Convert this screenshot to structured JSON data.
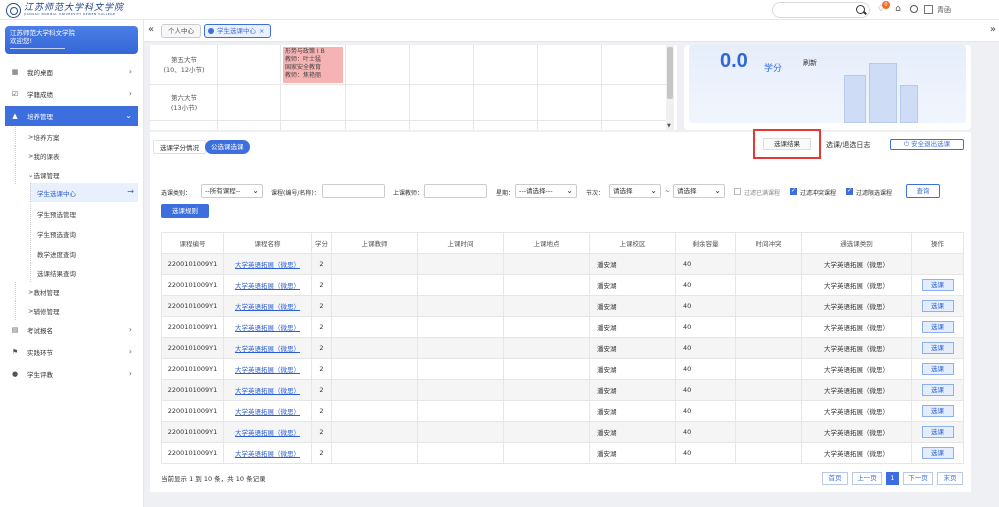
{
  "header": {
    "logo_cn": "江苏师范大学科文学院",
    "logo_en": "JIANGSU NORMAL UNIVERSITY KEWEN COLLEGE",
    "notification_count": "0",
    "user_name": "青函"
  },
  "sidebar": {
    "school_name": "江苏师范大学科文学院",
    "welcome": "欢迎您!",
    "items": [
      {
        "label": "我的桌面",
        "icon": "grid-icon"
      },
      {
        "label": "学籍成绩",
        "icon": "checkbox-icon"
      },
      {
        "label": "培养管理",
        "icon": "graduation-cap-icon"
      },
      {
        "label": "考试报名",
        "icon": "document-icon"
      },
      {
        "label": "实践环节",
        "icon": "flag-icon"
      },
      {
        "label": "学生评教",
        "icon": "person-icon"
      }
    ],
    "sub_items": [
      "培养方案",
      "我的课表",
      "选课管理",
      "教材管理",
      "辅修管理"
    ],
    "course_sub": [
      "学生选课中心",
      "学生预选管理",
      "学生预选查询",
      "教学进度查询",
      "选课结果查询"
    ]
  },
  "tabs": [
    {
      "label": "个人中心"
    },
    {
      "label": "学生选课中心"
    }
  ],
  "timetable": {
    "rows": [
      {
        "label_line1": "第五大节",
        "label_line2": "(10、12小节)"
      },
      {
        "label_line1": "第六大节",
        "label_line2": "(13小节)"
      }
    ],
    "course_block": [
      "形势与政策 I B",
      "教师：叶士猛",
      "国家安全教育",
      "教师：焦艳丽"
    ]
  },
  "credit": {
    "value": "0.0",
    "unit": "学分",
    "refresh_label": "刷新"
  },
  "actions": {
    "result_label": "选课结果",
    "log_label": "选课/退选日志",
    "exit_label": "安全退出选课"
  },
  "subtabs": {
    "credit_status": "选课学分情况",
    "public_elective": "公选课选课"
  },
  "filters": {
    "category_label": "选课类别：",
    "category_value": "--所有课程--",
    "course_label": "课程(编号/名称)：",
    "teacher_label": "上课教师：",
    "week_label": "星期：",
    "week_value": "---请选择---",
    "period_label": "节次：",
    "period_from": "请选择",
    "period_sep": "~",
    "period_to": "请选择",
    "opt_full": "过滤已满课程",
    "opt_conflict": "过滤冲突课程",
    "opt_restricted": "过滤限选课程",
    "query_label": "查询",
    "rules_label": "选课规则"
  },
  "table": {
    "headers": [
      "课程编号",
      "课程名称",
      "学分",
      "上课教师",
      "上课时间",
      "上课地点",
      "上课校区",
      "剩余容量",
      "时间冲突",
      "通选课类别",
      "操作"
    ],
    "rows": [
      {
        "code": "2200101009Y1",
        "name": "大学英语拓展（微思）",
        "credit": "2",
        "teacher": "",
        "time": "",
        "place": "",
        "campus": "潘安湖",
        "remain": "40",
        "conflict": "",
        "category": "大学英语拓展（微思）",
        "op": ""
      },
      {
        "code": "2200101009Y1",
        "name": "大学英语拓展（微思）",
        "credit": "2",
        "teacher": "",
        "time": "",
        "place": "",
        "campus": "潘安湖",
        "remain": "40",
        "conflict": "",
        "category": "大学英语拓展（微思）",
        "op": "选课"
      },
      {
        "code": "2200101009Y1",
        "name": "大学英语拓展（微思）",
        "credit": "2",
        "teacher": "",
        "time": "",
        "place": "",
        "campus": "潘安湖",
        "remain": "40",
        "conflict": "",
        "category": "大学英语拓展（微思）",
        "op": "选课"
      },
      {
        "code": "2200101009Y1",
        "name": "大学英语拓展（微思）",
        "credit": "2",
        "teacher": "",
        "time": "",
        "place": "",
        "campus": "潘安湖",
        "remain": "40",
        "conflict": "",
        "category": "大学英语拓展（微思）",
        "op": "选课"
      },
      {
        "code": "2200101009Y1",
        "name": "大学英语拓展（微思）",
        "credit": "2",
        "teacher": "",
        "time": "",
        "place": "",
        "campus": "潘安湖",
        "remain": "40",
        "conflict": "",
        "category": "大学英语拓展（微思）",
        "op": "选课"
      },
      {
        "code": "2200101009Y1",
        "name": "大学英语拓展（微思）",
        "credit": "2",
        "teacher": "",
        "time": "",
        "place": "",
        "campus": "潘安湖",
        "remain": "40",
        "conflict": "",
        "category": "大学英语拓展（微思）",
        "op": "选课"
      },
      {
        "code": "2200101009Y1",
        "name": "大学英语拓展（微思）",
        "credit": "2",
        "teacher": "",
        "time": "",
        "place": "",
        "campus": "潘安湖",
        "remain": "40",
        "conflict": "",
        "category": "大学英语拓展（微思）",
        "op": "选课"
      },
      {
        "code": "2200101009Y1",
        "name": "大学英语拓展（微思）",
        "credit": "2",
        "teacher": "",
        "time": "",
        "place": "",
        "campus": "潘安湖",
        "remain": "40",
        "conflict": "",
        "category": "大学英语拓展（微思）",
        "op": "选课"
      },
      {
        "code": "2200101009Y1",
        "name": "大学英语拓展（微思）",
        "credit": "2",
        "teacher": "",
        "time": "",
        "place": "",
        "campus": "潘安湖",
        "remain": "40",
        "conflict": "",
        "category": "大学英语拓展（微思）",
        "op": "选课"
      },
      {
        "code": "2200101009Y1",
        "name": "大学英语拓展（微思）",
        "credit": "2",
        "teacher": "",
        "time": "",
        "place": "",
        "campus": "潘安湖",
        "remain": "40",
        "conflict": "",
        "category": "大学英语拓展（微思）",
        "op": "选课"
      }
    ]
  },
  "pagination": {
    "summary": "当前显示 1 到 10 条，共 10 条记录",
    "first": "首页",
    "prev": "上一页",
    "current": "1",
    "next": "下一页",
    "last": "末页"
  }
}
